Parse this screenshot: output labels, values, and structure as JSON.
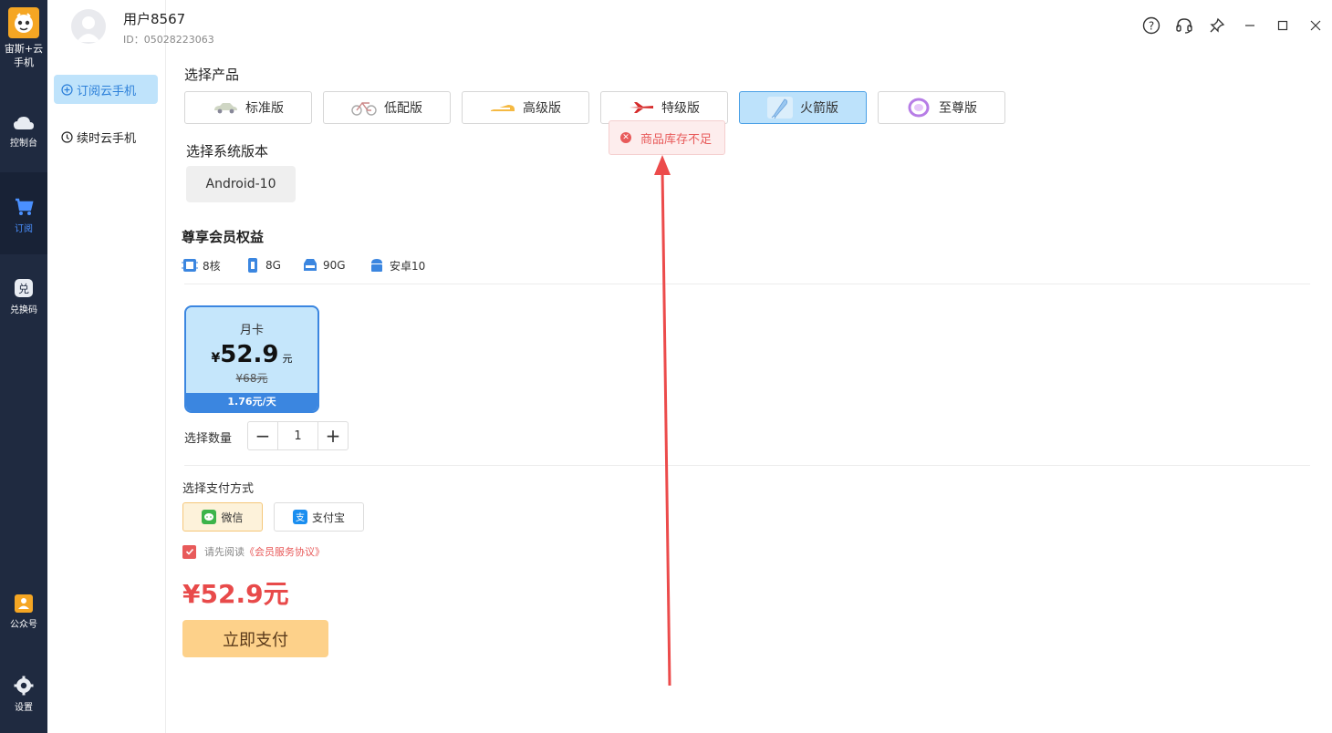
{
  "app": {
    "name": "宙斯+云手机"
  },
  "leftbar": {
    "items": [
      {
        "label": "控制台",
        "icon": "cloud-icon"
      },
      {
        "label": "订阅",
        "icon": "cart-icon"
      },
      {
        "label": "兑换码",
        "icon": "redeem-icon"
      },
      {
        "label": "公众号",
        "icon": "official-account-icon"
      },
      {
        "label": "设置",
        "icon": "gear-icon"
      }
    ]
  },
  "submenu": {
    "items": [
      {
        "label": "订阅云手机",
        "icon": "plus-circle-icon"
      },
      {
        "label": "续时云手机",
        "icon": "clock-circle-icon"
      }
    ]
  },
  "header": {
    "username": "用户8567",
    "user_id": "ID：05028223063"
  },
  "products": {
    "title": "选择产品",
    "items": [
      {
        "label": "标准版",
        "icon": "car-icon"
      },
      {
        "label": "低配版",
        "icon": "bicycle-icon"
      },
      {
        "label": "高级版",
        "icon": "train-icon"
      },
      {
        "label": "特级版",
        "icon": "plane-icon"
      },
      {
        "label": "火箭版",
        "icon": "rocket-icon"
      },
      {
        "label": "至尊版",
        "icon": "ring-icon"
      }
    ],
    "selected": "火箭版"
  },
  "toast": {
    "text": "商品库存不足"
  },
  "system": {
    "title": "选择系统版本",
    "version": "Android-10"
  },
  "benefits": {
    "title": "尊享会员权益",
    "items": [
      {
        "label": "8核",
        "icon": "cpu-icon"
      },
      {
        "label": "8G",
        "icon": "memory-icon"
      },
      {
        "label": "90G",
        "icon": "storage-icon"
      },
      {
        "label": "安卓10",
        "icon": "android-icon"
      }
    ]
  },
  "plan": {
    "name": "月卡",
    "currency": "¥",
    "price": "52.9",
    "unit": "元",
    "original": "¥68元",
    "per_day": "1.76元/天"
  },
  "quantity": {
    "label": "选择数量",
    "value": "1",
    "minus": "−",
    "plus": "+"
  },
  "payment": {
    "title": "选择支付方式",
    "methods": [
      {
        "label": "微信",
        "icon": "wechat-icon"
      },
      {
        "label": "支付宝",
        "icon": "alipay-icon"
      }
    ],
    "selected": "微信"
  },
  "agreement": {
    "prefix": "请先阅读",
    "link": "《会员服务协议》"
  },
  "total": "¥52.9元",
  "pay_button": "立即支付",
  "colors": {
    "accent": "#3b86e0",
    "danger": "#e84a4a",
    "sidebar": "#1f2a40",
    "pay": "#fdd18a"
  }
}
